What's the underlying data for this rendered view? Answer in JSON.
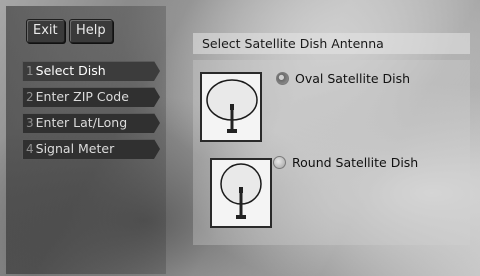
{
  "header": {
    "exit_label": "Exit",
    "help_label": "Help"
  },
  "title": "Select Satellite Dish Antenna",
  "menu": {
    "items": [
      {
        "number": "1",
        "label": "Select Dish",
        "active": true
      },
      {
        "number": "2",
        "label": "Enter ZIP Code",
        "active": false
      },
      {
        "number": "3",
        "label": "Enter Lat/Long",
        "active": false
      },
      {
        "number": "4",
        "label": "Signal Meter",
        "active": false
      }
    ]
  },
  "options": [
    {
      "label": "Oval Satellite Dish",
      "selected": true,
      "icon": "oval-dish-icon"
    },
    {
      "label": "Round Satellite Dish",
      "selected": false,
      "icon": "round-dish-icon"
    }
  ],
  "colors": {
    "menu_bg": "#303030",
    "menu_text": "#dcdcdc",
    "title_bg": "#e6e6e6"
  }
}
